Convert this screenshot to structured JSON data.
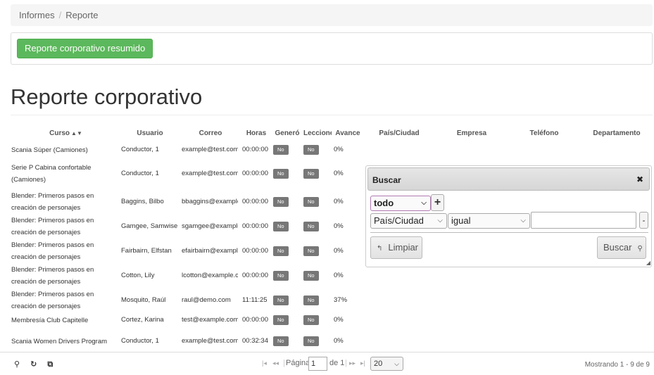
{
  "breadcrumb": {
    "items": [
      "Informes",
      "Reporte"
    ]
  },
  "actions": {
    "summary_label": "Reporte corporativo resumido"
  },
  "page": {
    "title": "Reporte corporativo"
  },
  "columns": {
    "curso": "Curso",
    "usuario": "Usuario",
    "correo": "Correo",
    "horas": "Horas",
    "genero": "Generó",
    "lecciones": "Lecciones",
    "avance": "Avance",
    "pais": "País/Ciudad",
    "empresa": "Empresa",
    "telefono": "Teléfono",
    "departamento": "Departamento"
  },
  "rows": [
    {
      "curso": "Scania Súper (Camiones)",
      "usuario": "Conductor, 1",
      "correo": "example@test.com",
      "horas": "00:00:00",
      "genero": "No",
      "lecciones": "No",
      "avance": "0%"
    },
    {
      "curso": "Serie P Cabina confortable (Camiones)",
      "usuario": "Conductor, 1",
      "correo": "example@test.com",
      "horas": "00:00:00",
      "genero": "No",
      "lecciones": "No",
      "avance": "0%"
    },
    {
      "curso": "Blender: Primeros pasos en creación de personajes",
      "usuario": "Baggins, Bilbo",
      "correo": "bbaggins@example.com",
      "horas": "00:00:00",
      "genero": "No",
      "lecciones": "No",
      "avance": "0%"
    },
    {
      "curso": "Blender: Primeros pasos en creación de personajes",
      "usuario": "Gamgee, Samwise",
      "correo": "sgamgee@example.com",
      "horas": "00:00:00",
      "genero": "No",
      "lecciones": "No",
      "avance": "0%"
    },
    {
      "curso": "Blender: Primeros pasos en creación de personajes",
      "usuario": "Fairbairn, Elfstan",
      "correo": "efairbairn@example.com",
      "horas": "00:00:00",
      "genero": "No",
      "lecciones": "No",
      "avance": "0%"
    },
    {
      "curso": "Blender: Primeros pasos en creación de personajes",
      "usuario": "Cotton, Lily",
      "correo": "lcotton@example.com",
      "horas": "00:00:00",
      "genero": "No",
      "lecciones": "No",
      "avance": "0%"
    },
    {
      "curso": "Blender: Primeros pasos en creación de personajes",
      "usuario": "Mosquito, Raúl",
      "correo": "raul@demo.com",
      "horas": "11:11:25",
      "genero": "No",
      "lecciones": "No",
      "avance": "37%"
    },
    {
      "curso": "Membresía Club Capitelle",
      "usuario": "Cortez, Karina",
      "correo": "test@example.com",
      "horas": "00:00:00",
      "genero": "No",
      "lecciones": "No",
      "avance": "0%"
    },
    {
      "curso": "Scania Women Drivers Program",
      "usuario": "Conductor, 1",
      "correo": "example@test.com",
      "horas": "00:32:34",
      "genero": "No",
      "lecciones": "No",
      "avance": "0%"
    }
  ],
  "search": {
    "title": "Buscar",
    "group_op": "todo",
    "field": "País/Ciudad",
    "operator": "igual",
    "value": "",
    "reset_label": "Limpiar",
    "find_label": "Buscar"
  },
  "pager": {
    "page_label": "Página",
    "page_value": "1",
    "of_label": "de 1",
    "page_size": "20",
    "showing": "Mostrando 1 - 9 de 9"
  }
}
